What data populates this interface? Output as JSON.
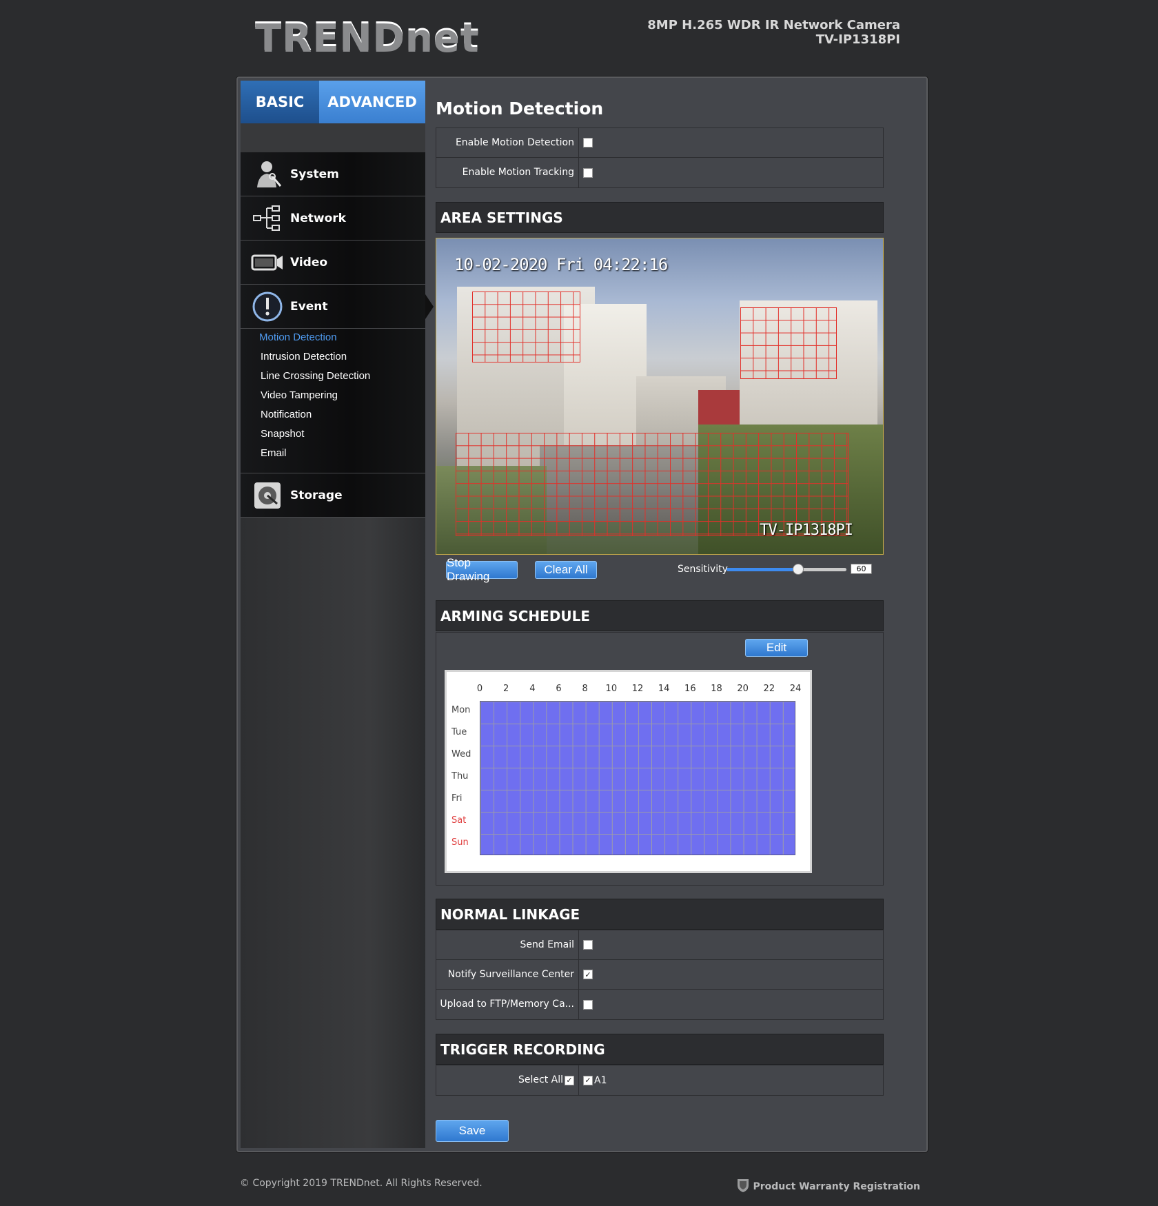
{
  "brand": {
    "logo": "TRENDnet"
  },
  "header": {
    "model_line1": "8MP H.265 WDR IR Network Camera",
    "model_line2": "TV-IP1318PI"
  },
  "tabs": {
    "basic": "BASIC",
    "advanced": "ADVANCED"
  },
  "nav": {
    "system": "System",
    "network": "Network",
    "video": "Video",
    "event": "Event",
    "storage": "Storage",
    "event_sub": [
      "Motion Detection",
      "Intrusion Detection",
      "Line Crossing Detection",
      "Video Tampering",
      "Notification",
      "Snapshot",
      "Email"
    ]
  },
  "page": {
    "title": "Motion Detection"
  },
  "motion": {
    "enable_label": "Enable Motion Detection",
    "enable_checked": false,
    "tracking_label": "Enable Motion Tracking",
    "tracking_checked": false
  },
  "area": {
    "heading": "AREA SETTINGS",
    "timestamp": "10-02-2020 Fri 04:22:16",
    "watermark": "TV-IP1318PI",
    "stop_drawing": "Stop Drawing",
    "clear_all": "Clear All",
    "sensitivity_label": "Sensitivity",
    "sensitivity_value": "60",
    "sensitivity_fraction": 0.6
  },
  "schedule": {
    "heading": "ARMING SCHEDULE",
    "edit": "Edit",
    "hours": [
      "0",
      "2",
      "4",
      "6",
      "8",
      "10",
      "12",
      "14",
      "16",
      "18",
      "20",
      "22",
      "24"
    ],
    "days": [
      "Mon",
      "Tue",
      "Wed",
      "Thu",
      "Fri",
      "Sat",
      "Sun"
    ],
    "fill_color": "#6f6ff0"
  },
  "linkage": {
    "heading": "NORMAL LINKAGE",
    "send_email": "Send Email",
    "send_email_checked": false,
    "notify": "Notify Surveillance Center",
    "notify_checked": true,
    "upload": "Upload to FTP/Memory Ca...",
    "upload_checked": false
  },
  "trigger": {
    "heading": "TRIGGER RECORDING",
    "select_all": "Select All",
    "select_all_checked": true,
    "a1": "A1",
    "a1_checked": true
  },
  "save": "Save",
  "footer": {
    "copyright": "© Copyright 2019 TRENDnet. All Rights Reserved.",
    "warranty": "Product Warranty Registration"
  },
  "colors": {
    "accent": "#3a7fd0",
    "active_link": "#4f9bf0",
    "grid_line": "#e2302a"
  }
}
